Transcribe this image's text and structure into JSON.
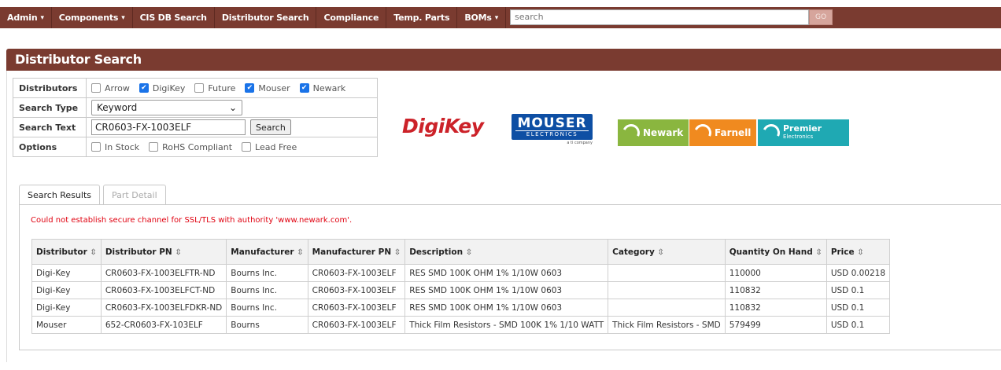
{
  "nav": {
    "items": [
      {
        "label": "Admin",
        "caret": "▾"
      },
      {
        "label": "Components",
        "caret": "▾"
      },
      {
        "label": "CIS DB Search",
        "caret": ""
      },
      {
        "label": "Distributor Search",
        "caret": ""
      },
      {
        "label": "Compliance",
        "caret": ""
      },
      {
        "label": "Temp. Parts",
        "caret": ""
      },
      {
        "label": "BOMs",
        "caret": "▾"
      }
    ],
    "search_placeholder": "search",
    "go_label": "GO"
  },
  "page": {
    "title": "Distributor Search"
  },
  "form": {
    "distributors_label": "Distributors",
    "distributors": [
      {
        "name": "Arrow",
        "checked": false
      },
      {
        "name": "DigiKey",
        "checked": true
      },
      {
        "name": "Future",
        "checked": false
      },
      {
        "name": "Mouser",
        "checked": true
      },
      {
        "name": "Newark",
        "checked": true
      }
    ],
    "search_type_label": "Search Type",
    "search_type_value": "Keyword",
    "search_text_label": "Search Text",
    "search_text_value": "CR0603-FX-1003ELF",
    "search_button": "Search",
    "options_label": "Options",
    "options": [
      {
        "name": "In Stock",
        "checked": false
      },
      {
        "name": "RoHS Compliant",
        "checked": false
      },
      {
        "name": "Lead Free",
        "checked": false
      }
    ]
  },
  "logos": {
    "digikey": "DigiKey",
    "mouser_main": "MOUSER",
    "mouser_sub": "ELECTRONICS",
    "mouser_ti": "a ti company",
    "newark": "Newark",
    "farnell": "Farnell",
    "premier": "Premier",
    "premier_sub": "Electronics"
  },
  "tabs": [
    {
      "label": "Search Results",
      "active": true
    },
    {
      "label": "Part Detail",
      "active": false
    }
  ],
  "error": "Could not establish secure channel for SSL/TLS with authority 'www.newark.com'.",
  "results": {
    "columns": [
      "Distributor",
      "Distributor PN",
      "Manufacturer",
      "Manufacturer PN",
      "Description",
      "Category",
      "Quantity On Hand",
      "Price"
    ],
    "sort_glyph": "⇳",
    "rows": [
      [
        "Digi-Key",
        "CR0603-FX-1003ELFTR-ND",
        "Bourns Inc.",
        "CR0603-FX-1003ELF",
        "RES SMD 100K OHM 1% 1/10W 0603",
        "",
        "110000",
        "USD 0.00218"
      ],
      [
        "Digi-Key",
        "CR0603-FX-1003ELFCT-ND",
        "Bourns Inc.",
        "CR0603-FX-1003ELF",
        "RES SMD 100K OHM 1% 1/10W 0603",
        "",
        "110832",
        "USD 0.1"
      ],
      [
        "Digi-Key",
        "CR0603-FX-1003ELFDKR-ND",
        "Bourns Inc.",
        "CR0603-FX-1003ELF",
        "RES SMD 100K OHM 1% 1/10W 0603",
        "",
        "110832",
        "USD 0.1"
      ],
      [
        "Mouser",
        "652-CR0603-FX-103ELF",
        "Bourns",
        "CR0603-FX-1003ELF",
        "Thick Film Resistors - SMD 100K 1% 1/10 WATT",
        "Thick Film Resistors - SMD",
        "579499",
        "USD 0.1"
      ]
    ]
  }
}
